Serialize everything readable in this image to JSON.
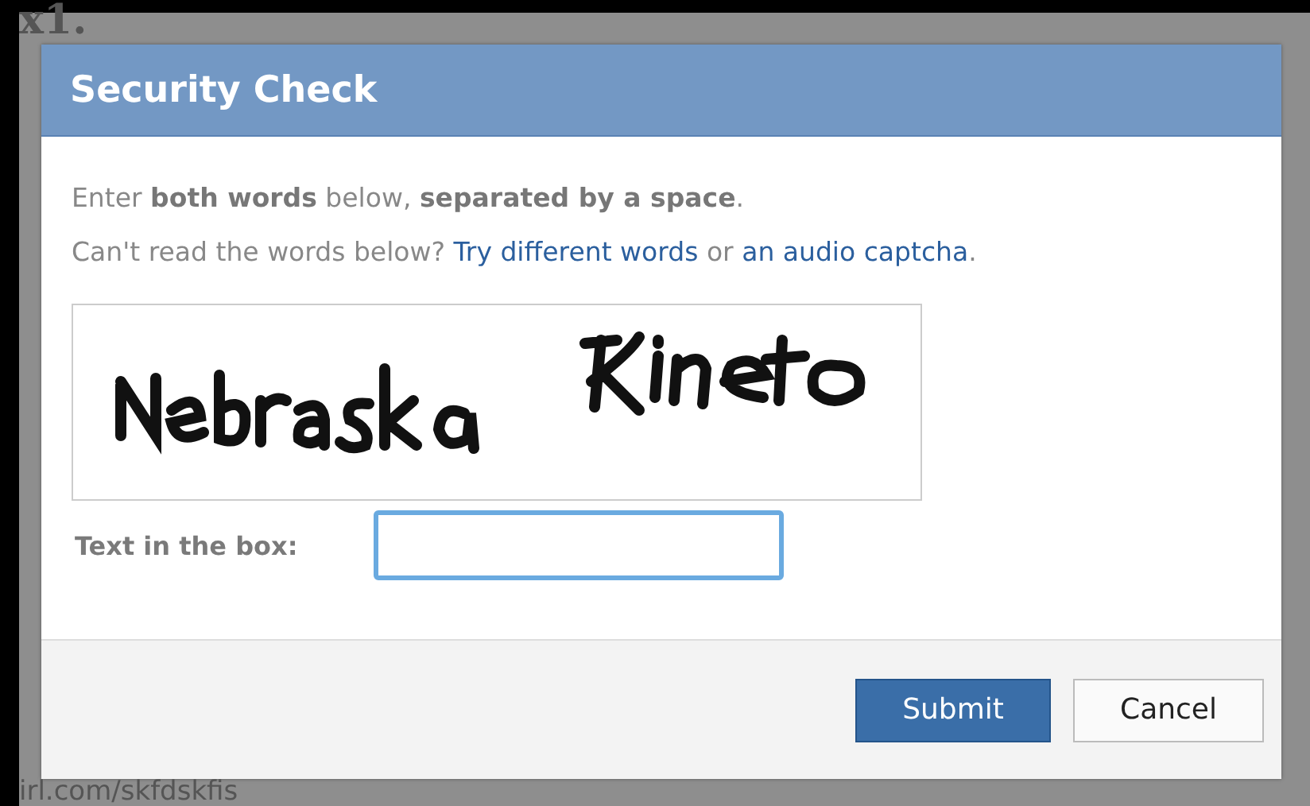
{
  "background": {
    "heading": "x1.",
    "url": "irl.com/skfdskfis"
  },
  "dialog": {
    "title": "Security Check",
    "instruction": "Enter **both words** below, **separated by a space**.",
    "help": {
      "text": "Can't read the words below?",
      "link_1": "Try different words",
      "separator": "or",
      "link_2": "an audio captcha",
      "end": "."
    },
    "field": {
      "label": "Text in the box:",
      "focused": true
    },
    "buttons": [
      {
        "label": "Submit",
        "kind": "primary"
      },
      {
        "label": "Cancel",
        "kind": "secondary"
      }
    ]
  }
}
